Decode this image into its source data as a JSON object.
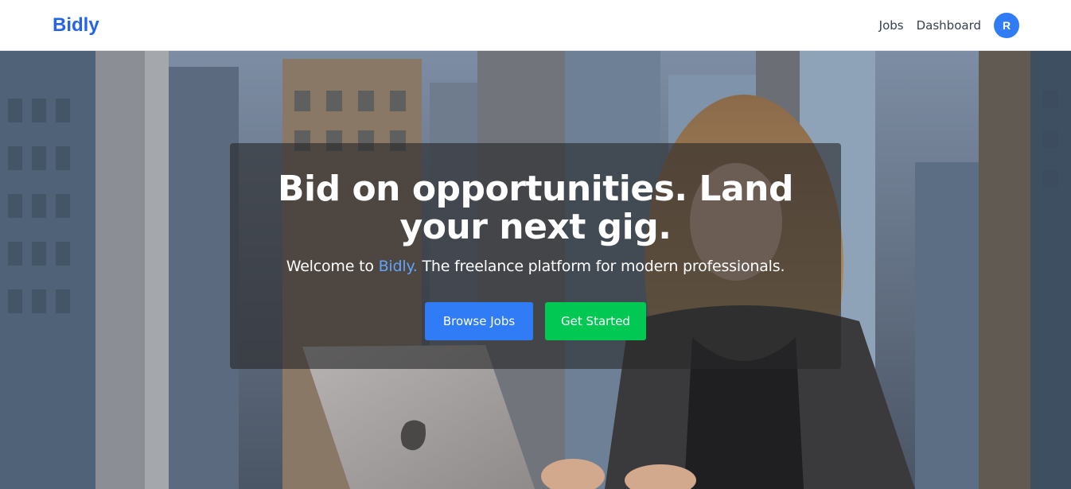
{
  "nav": {
    "brand": "Bidly",
    "links": {
      "jobs": "Jobs",
      "dashboard": "Dashboard"
    },
    "avatar_initial": "R"
  },
  "hero": {
    "headline": "Bid on opportunities. Land your next gig.",
    "sub_prefix": "Welcome to ",
    "sub_brand": "Bidly.",
    "sub_suffix": " The freelance platform for modern professionals.",
    "buttons": {
      "browse": "Browse Jobs",
      "start": "Get Started"
    }
  },
  "colors": {
    "brand": "#2563eb",
    "primary_button": "#2f7cf6",
    "success_button": "#00c853",
    "accent_text": "#60a5fa"
  }
}
